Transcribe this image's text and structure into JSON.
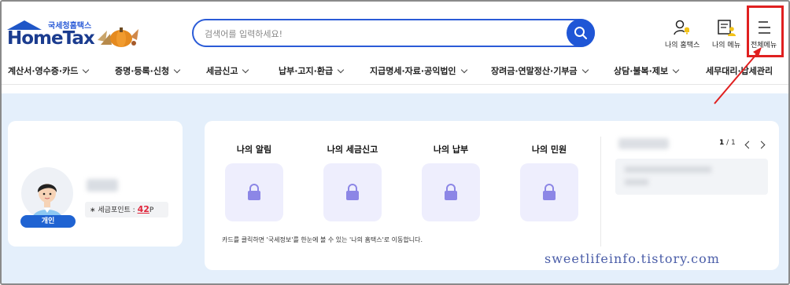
{
  "header": {
    "logo_small": "국세청홈택스",
    "logo_main": "HomeTax",
    "search_placeholder": "검색어를 입력하세요!",
    "icons": {
      "my_hometax": "나의 홈택스",
      "my_menu": "나의 메뉴",
      "all_menu": "전체메뉴"
    }
  },
  "nav": {
    "items": [
      "계산서·영수증·카드",
      "증명·등록·신청",
      "세금신고",
      "납부·고지·환급",
      "지급명세·자료·공익법인",
      "장려금·연말정산·기부금",
      "상담·불복·제보",
      "세무대리·납세관리"
    ]
  },
  "profile": {
    "badge": "개인",
    "points_label": "세금포인트 :",
    "points_value": "42",
    "points_unit": "P"
  },
  "cards": {
    "items": [
      "나의 알림",
      "나의 세금신고",
      "나의 납부",
      "나의 민원"
    ],
    "note": "카드를 클릭하면 '국세정보'를 한눈에 볼 수 있는 '나의 홈택스'로 이동합니다."
  },
  "pager": {
    "current": "1",
    "total": "/ 1"
  },
  "watermark": "sweetlifeinfo.tistory.com",
  "colors": {
    "brand_blue": "#1f56d6",
    "highlight_red": "#e02020",
    "background": "#e4effb"
  }
}
